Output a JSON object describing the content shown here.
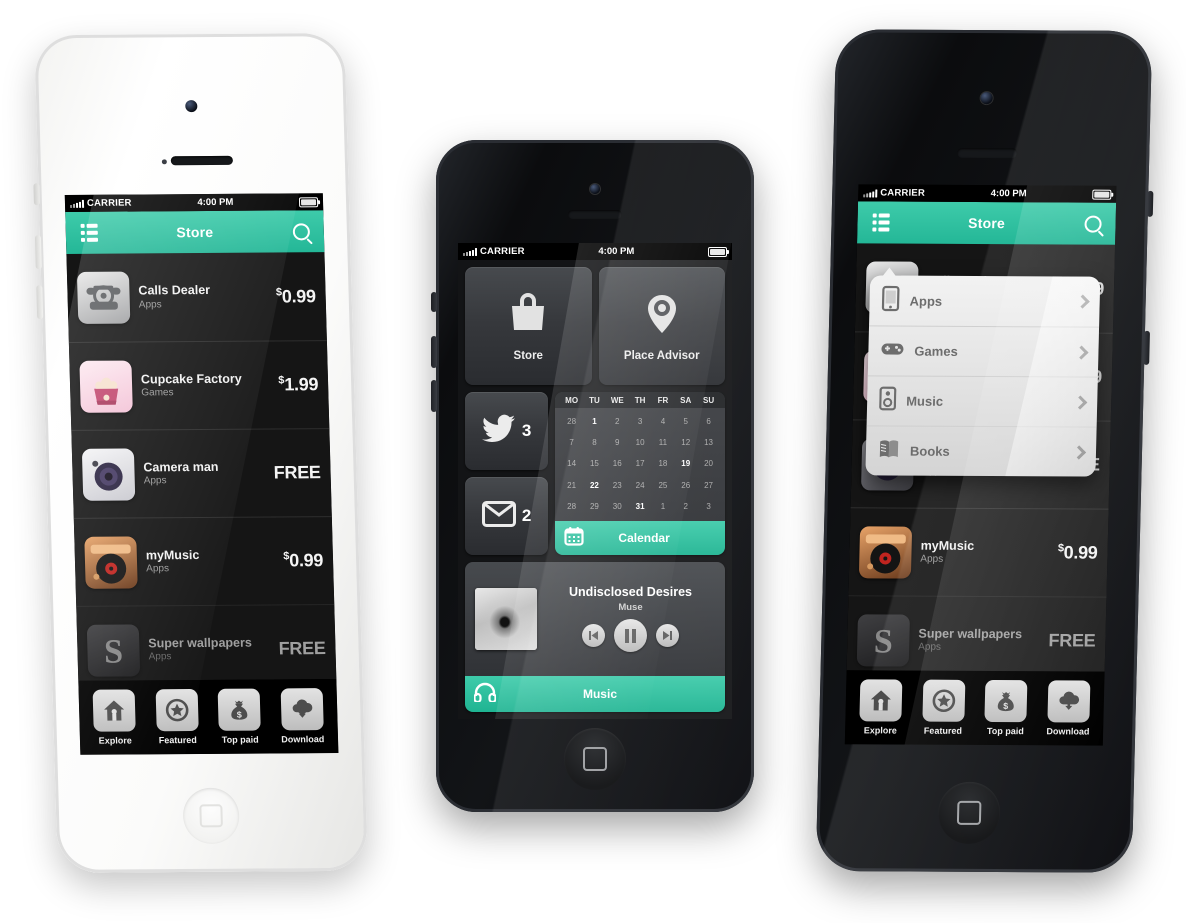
{
  "scene": {
    "title": "Mobile app store UI mockup on three iPhones",
    "accent": "#2bbd9b",
    "accent_light": "#3ecbaa",
    "background": "#ffffff"
  },
  "status_bar": {
    "carrier": "CARRIER",
    "time": "4:00 PM",
    "signal_icon": "signal-bars-icon",
    "battery_icon": "battery-icon"
  },
  "navbar": {
    "title": "Store",
    "menu_icon": "list-menu-icon",
    "search_icon": "search-icon"
  },
  "store_list": {
    "items": [
      {
        "name": "Calls Dealer",
        "category": "Apps",
        "price": "0.99",
        "currency": "$",
        "free": false,
        "icon": "rotary-phone-icon"
      },
      {
        "name": "Cupcake Factory",
        "category": "Games",
        "price": "1.99",
        "currency": "$",
        "free": false,
        "icon": "cupcake-icon"
      },
      {
        "name": "Camera man",
        "category": "Apps",
        "price": "FREE",
        "currency": "",
        "free": true,
        "icon": "camera-lens-icon"
      },
      {
        "name": "myMusic",
        "category": "Apps",
        "price": "0.99",
        "currency": "$",
        "free": false,
        "icon": "turntable-icon"
      },
      {
        "name": "Super wallpapers",
        "category": "Apps",
        "price": "FREE",
        "currency": "",
        "free": true,
        "icon": "s-letter-icon"
      }
    ]
  },
  "tabbar": {
    "tabs": [
      {
        "label": "Explore",
        "icon": "home-icon"
      },
      {
        "label": "Featured",
        "icon": "star-circle-icon"
      },
      {
        "label": "Top paid",
        "icon": "money-bag-icon"
      },
      {
        "label": "Download",
        "icon": "cloud-download-icon"
      }
    ]
  },
  "dropdown": {
    "items": [
      {
        "label": "Apps",
        "icon": "smartphone-icon",
        "chevron": "chevron-right-icon"
      },
      {
        "label": "Games",
        "icon": "gamepad-icon",
        "chevron": "chevron-right-icon"
      },
      {
        "label": "Music",
        "icon": "speaker-icon",
        "chevron": "chevron-right-icon"
      },
      {
        "label": "Books",
        "icon": "book-icon",
        "chevron": "chevron-right-icon"
      }
    ]
  },
  "dashboard": {
    "tiles": [
      {
        "label": "Store",
        "icon": "shopping-bag-icon"
      },
      {
        "label": "Place Advisor",
        "icon": "map-pin-icon"
      }
    ],
    "twitter": {
      "icon": "twitter-bird-icon",
      "count": "3"
    },
    "mail": {
      "icon": "envelope-icon",
      "count": "2"
    },
    "calendar": {
      "label": "Calendar",
      "icon": "calendar-icon",
      "weekdays": [
        "MO",
        "TU",
        "WE",
        "TH",
        "FR",
        "SA",
        "SU"
      ],
      "weeks": [
        [
          {
            "d": "28",
            "hi": false
          },
          {
            "d": "1",
            "hi": true
          },
          {
            "d": "2",
            "hi": false
          },
          {
            "d": "3",
            "hi": false
          },
          {
            "d": "4",
            "hi": false
          },
          {
            "d": "5",
            "hi": false
          },
          {
            "d": "6",
            "hi": false
          }
        ],
        [
          {
            "d": "7",
            "hi": false
          },
          {
            "d": "8",
            "hi": false
          },
          {
            "d": "9",
            "hi": false
          },
          {
            "d": "10",
            "hi": false
          },
          {
            "d": "11",
            "hi": false
          },
          {
            "d": "12",
            "hi": false
          },
          {
            "d": "13",
            "hi": false
          }
        ],
        [
          {
            "d": "14",
            "hi": false
          },
          {
            "d": "15",
            "hi": false
          },
          {
            "d": "16",
            "hi": false
          },
          {
            "d": "17",
            "hi": false
          },
          {
            "d": "18",
            "hi": false
          },
          {
            "d": "19",
            "hi": true
          },
          {
            "d": "20",
            "hi": false
          }
        ],
        [
          {
            "d": "21",
            "hi": false
          },
          {
            "d": "22",
            "hi": true
          },
          {
            "d": "23",
            "hi": false
          },
          {
            "d": "24",
            "hi": false
          },
          {
            "d": "25",
            "hi": false
          },
          {
            "d": "26",
            "hi": false
          },
          {
            "d": "27",
            "hi": false
          }
        ],
        [
          {
            "d": "28",
            "hi": false
          },
          {
            "d": "29",
            "hi": false
          },
          {
            "d": "30",
            "hi": false
          },
          {
            "d": "31",
            "hi": true
          },
          {
            "d": "1",
            "hi": false
          },
          {
            "d": "2",
            "hi": false
          },
          {
            "d": "3",
            "hi": false
          }
        ]
      ]
    },
    "player": {
      "track": "Undisclosed Desires",
      "artist": "Muse",
      "label": "Music",
      "headphones_icon": "headphones-icon",
      "prev_icon": "skip-back-icon",
      "play_icon": "pause-icon",
      "next_icon": "skip-forward-icon",
      "cover_icon": "album-cover-art"
    }
  },
  "phones": [
    {
      "name": "phone-left-white",
      "finish": "white",
      "screen": "store-list"
    },
    {
      "name": "phone-center-black",
      "finish": "black",
      "screen": "dashboard"
    },
    {
      "name": "phone-right-black",
      "finish": "black",
      "screen": "store-list-with-dropdown"
    }
  ]
}
